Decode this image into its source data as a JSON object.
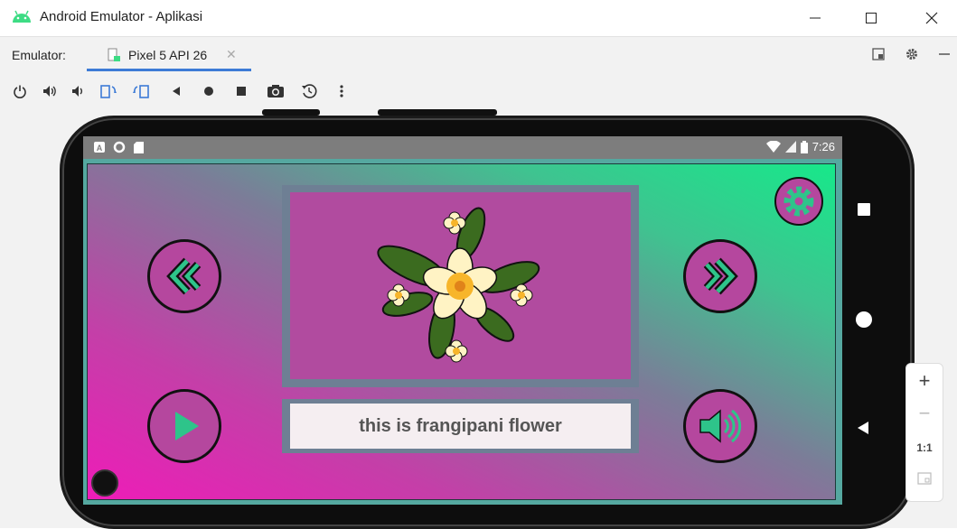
{
  "window": {
    "title": "Android Emulator - Aplikasi",
    "icon": "android-icon",
    "controls": [
      "minimize-icon",
      "maximize-icon",
      "close-icon"
    ]
  },
  "tabbar": {
    "label": "Emulator:",
    "active_tab": "Pixel 5 API 26",
    "close_glyph": "✕"
  },
  "toolbar": {
    "tools": [
      "power-icon",
      "volume-up-icon",
      "volume-down-icon",
      "rotate-left-icon",
      "rotate-right-icon",
      "back-icon",
      "home-icon",
      "overview-icon",
      "screenshot-icon",
      "snapshot-icon",
      "more-icon"
    ]
  },
  "device": {
    "status_time": "7:26",
    "app": {
      "caption": "this is frangipani flower",
      "colors": {
        "button_fill": "#b5479e",
        "frame": "#6e7f94",
        "gradient_pink": "#ee1cb8",
        "gradient_green": "#17e88a",
        "accent_teal": "#2ec48a"
      }
    }
  },
  "zoom": {
    "plus": "+",
    "minus": "−",
    "one_to_one": "1:1"
  }
}
